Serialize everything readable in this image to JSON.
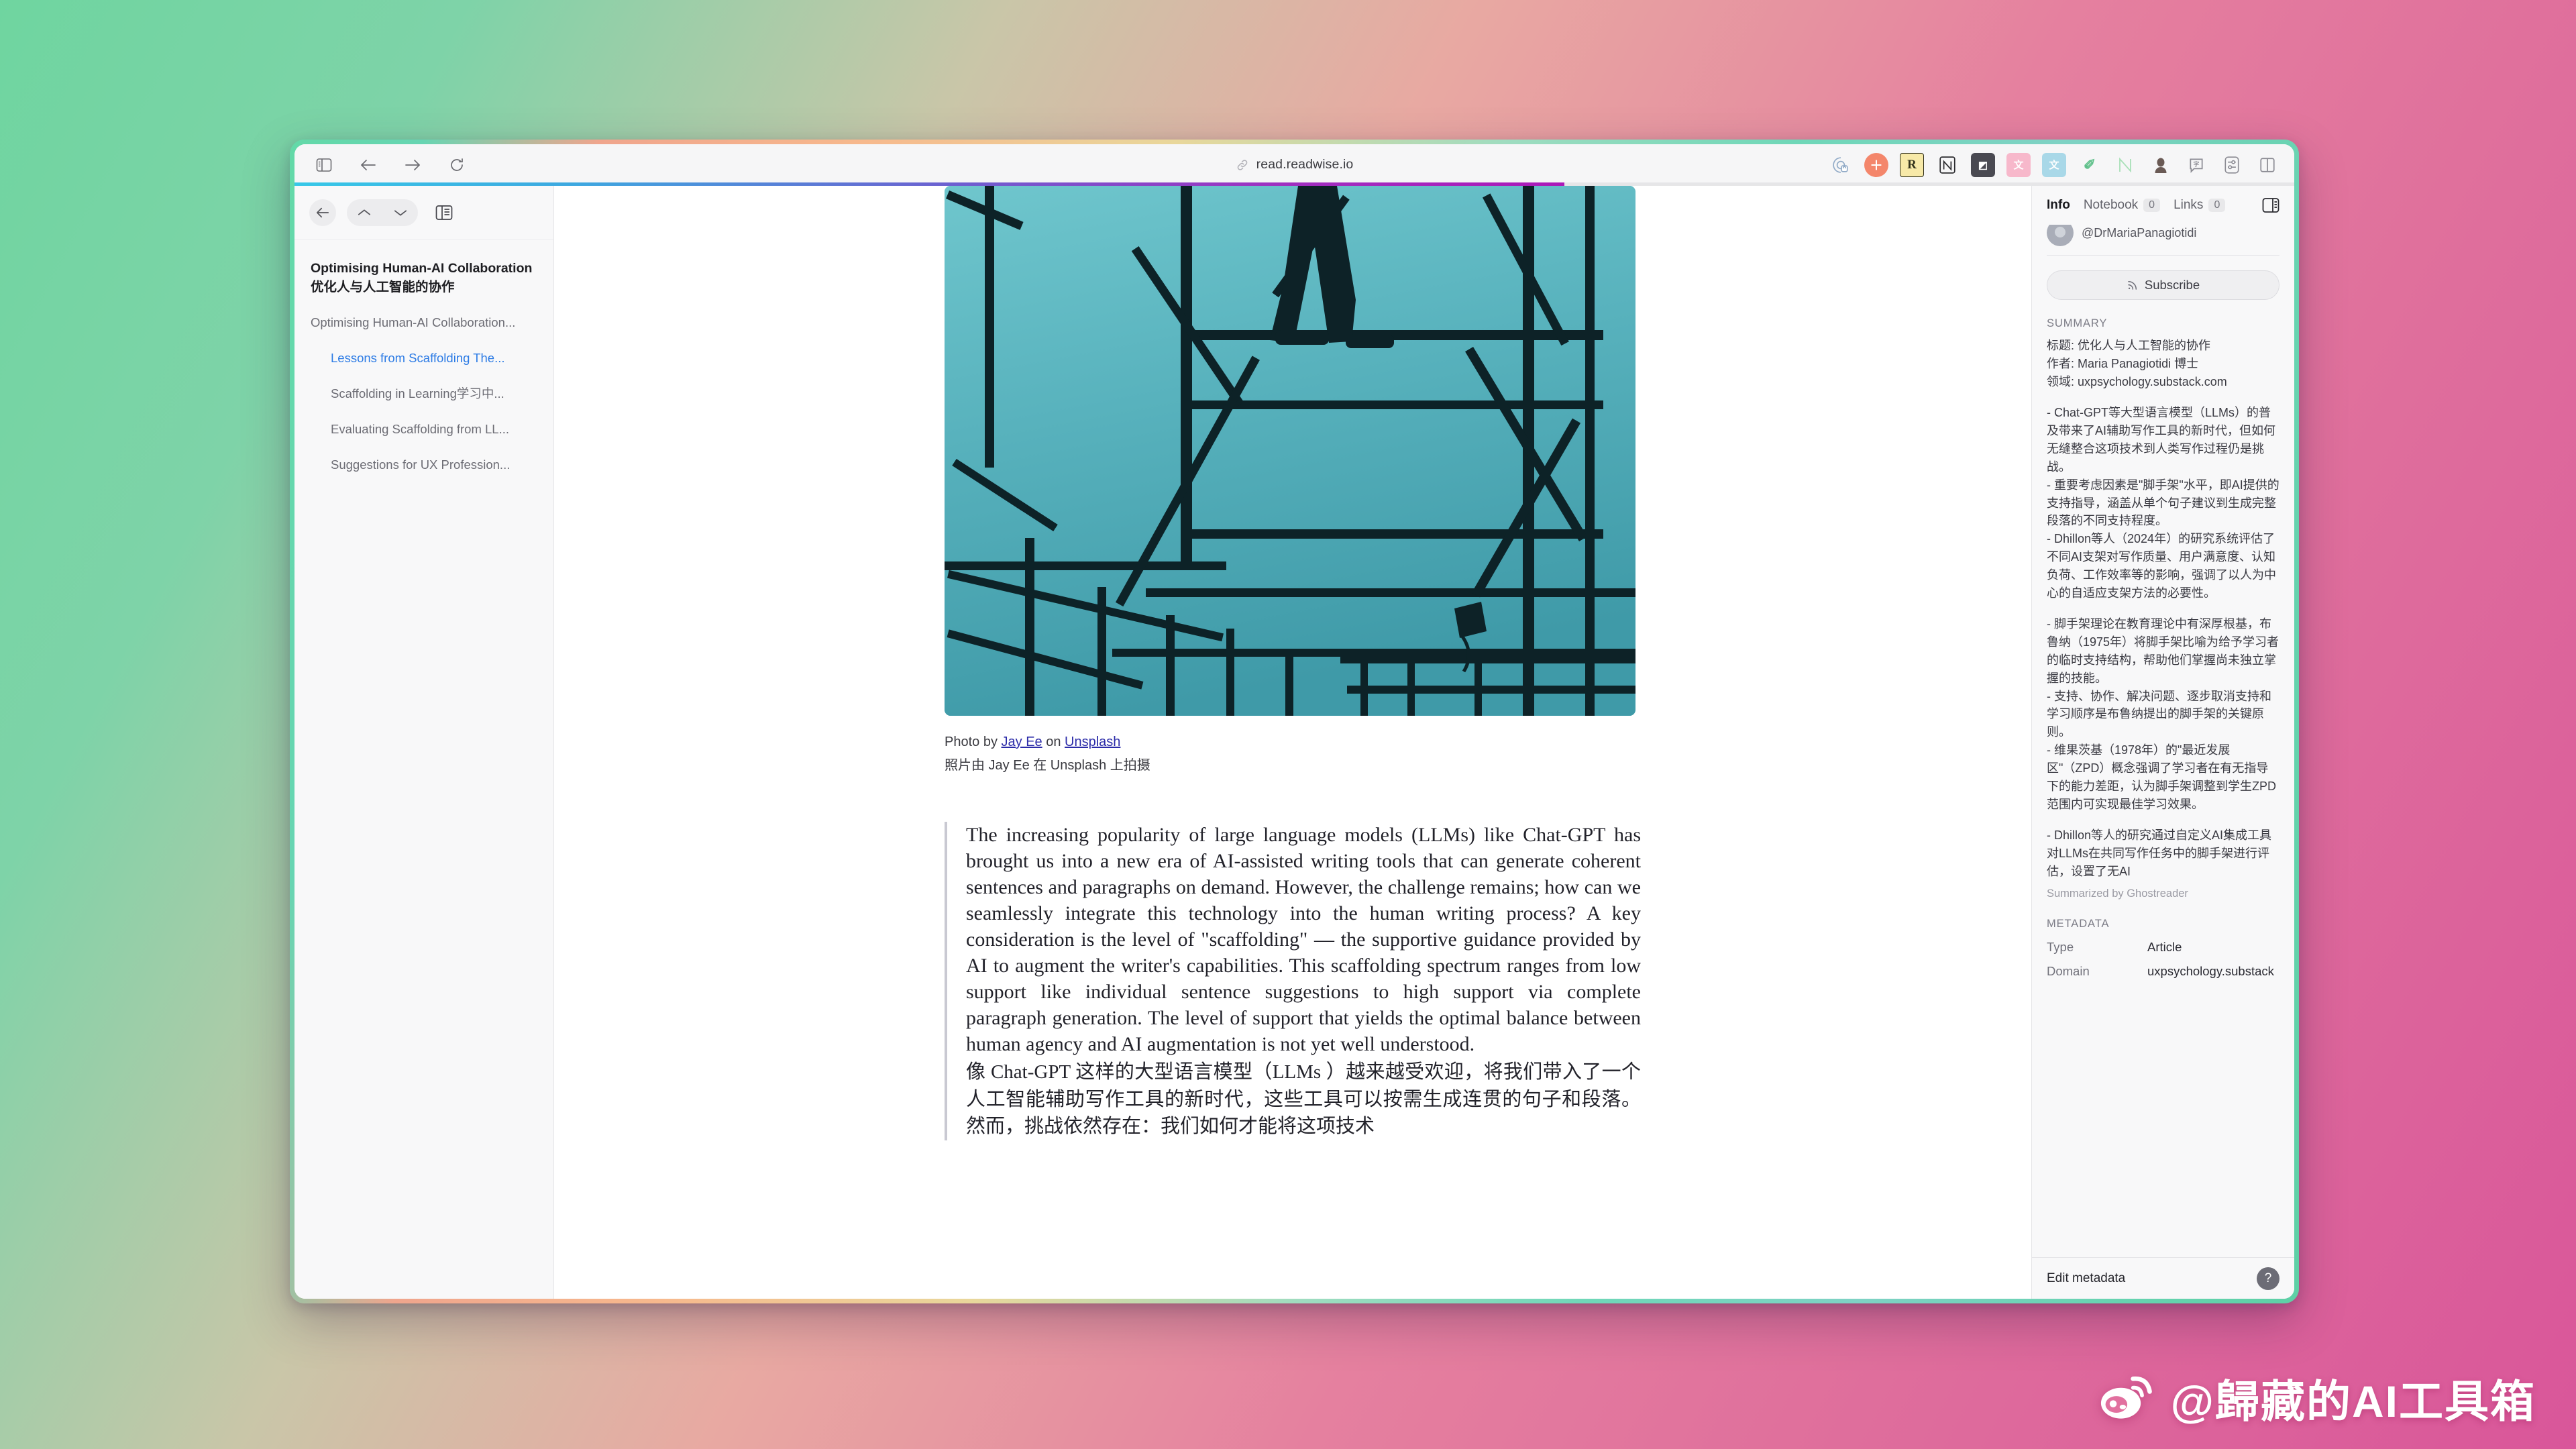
{
  "browser": {
    "url": "read.readwise.io",
    "nav": {
      "sidebar_toggle": "sidebar-toggle",
      "back": "back",
      "forward": "forward",
      "reload": "reload"
    },
    "extensions": [
      {
        "name": "privacy-badger-icon",
        "glyph": "◔",
        "bg": "transparent",
        "color": "#8fa9c6"
      },
      {
        "name": "orange-plus-extension-icon",
        "glyph": "✛",
        "bg": "#f4866b",
        "color": "#ffffff"
      },
      {
        "name": "readwise-extension-icon",
        "glyph": "R",
        "bg": "#f7e9a8",
        "color": "#3a3a22"
      },
      {
        "name": "notion-web-clipper-icon",
        "glyph": "N",
        "bg": "transparent",
        "color": "#2b2b2f"
      },
      {
        "name": "eagle-clip-extension-icon",
        "glyph": "◩",
        "bg": "#4a4a52",
        "color": "#ffffff"
      },
      {
        "name": "pink-translate-extension-icon",
        "glyph": "文",
        "bg": "#f7b8cb",
        "color": "#ffffff"
      },
      {
        "name": "immersive-translate-icon",
        "glyph": "文",
        "bg": "#a9d8e8",
        "color": "#ffffff"
      },
      {
        "name": "green-pen-extension-icon",
        "glyph": "✎",
        "bg": "transparent",
        "color": "#5fc08a"
      },
      {
        "name": "nimbus-extension-icon",
        "glyph": "N",
        "bg": "transparent",
        "color": "#a9e0b8"
      },
      {
        "name": "profile-avatar-icon",
        "glyph": "●",
        "bg": "transparent",
        "color": "#6a5a55"
      },
      {
        "name": "comment-bubble-extension-icon",
        "glyph": "⌨",
        "bg": "transparent",
        "color": "#8b8b93"
      },
      {
        "name": "settings-sliders-extension-icon",
        "glyph": "⚙",
        "bg": "transparent",
        "color": "#8b8b93"
      },
      {
        "name": "split-view-icon",
        "glyph": "◫",
        "bg": "transparent",
        "color": "#8b8b93"
      }
    ]
  },
  "sidebar": {
    "toolbar": {
      "back_label": "back",
      "prev_label": "previous",
      "next_label": "next",
      "panel_label": "document-outline"
    },
    "doc_title_en": "Optimising Human-AI Collaboration",
    "doc_title_zh": "优化人与人工智能的协作",
    "toc": [
      {
        "label": "Optimising Human-AI Collaboration...",
        "level": 1,
        "active": false
      },
      {
        "label": "Lessons from Scaffolding The...",
        "level": 2,
        "active": true
      },
      {
        "label": "Scaffolding in Learning学习中...",
        "level": 2,
        "active": false
      },
      {
        "label": "Evaluating Scaffolding from LL...",
        "level": 2,
        "active": false
      },
      {
        "label": "Suggestions for UX Profession...",
        "level": 2,
        "active": false
      }
    ]
  },
  "article": {
    "hero_alt": "scaffolding-photo",
    "caption": {
      "prefix": "Photo by ",
      "author": "Jay Ee",
      "middle": " on ",
      "source": "Unsplash",
      "zh": "照片由 Jay Ee 在 Unsplash 上拍摄"
    },
    "body_en": "The increasing popularity of large language models (LLMs) like Chat-GPT has brought us into a new era of AI-assisted writing tools that can generate coherent sentences and paragraphs on demand. However, the challenge remains; how can we seamlessly integrate this technology into the human writing process? A key consideration is the level of \"scaffolding\" — the supportive guidance provided by AI to augment the writer's capabilities. This scaffolding spectrum ranges from low support like individual sentence suggestions to high support via complete paragraph generation. The level of support that yields the optimal balance between human agency and AI augmentation is not yet well understood.",
    "body_zh": "像 Chat-GPT 这样的大型语言模型（LLMs ）越来越受欢迎，将我们带入了一个人工智能辅助写作工具的新时代，这些工具可以按需生成连贯的句子和段落。然而，挑战依然存在：我们如何才能将这项技术"
  },
  "info_panel": {
    "tabs": [
      {
        "label": "Info",
        "count": null,
        "active": true
      },
      {
        "label": "Notebook",
        "count": "0",
        "active": false
      },
      {
        "label": "Links",
        "count": "0",
        "active": false
      }
    ],
    "panel_toggle_name": "info-panel-toggle",
    "author_handle": "@DrMariaPanagiotidi",
    "subscribe_label": "Subscribe",
    "summary_label": "SUMMARY",
    "summary_head": "标题: 优化人与人工智能的协作\n作者: Maria Panagiotidi 博士\n领域: uxpsychology.substack.com",
    "summary_paragraphs": [
      "- Chat-GPT等大型语言模型（LLMs）的普及带来了AI辅助写作工具的新时代，但如何无缝整合这项技术到人类写作过程仍是挑战。\n- 重要考虑因素是\"脚手架\"水平，即AI提供的支持指导，涵盖从单个句子建议到生成完整段落的不同支持程度。\n- Dhillon等人（2024年）的研究系统评估了不同AI支架对写作质量、用户满意度、认知负荷、工作效率等的影响，强调了以人为中心的自适应支架方法的必要性。",
      "- 脚手架理论在教育理论中有深厚根基，布鲁纳（1975年）将脚手架比喻为给予学习者的临时支持结构，帮助他们掌握尚未独立掌握的技能。\n- 支持、协作、解决问题、逐步取消支持和学习顺序是布鲁纳提出的脚手架的关键原则。\n- 维果茨基（1978年）的\"最近发展区\"（ZPD）概念强调了学习者在有无指导下的能力差距，认为脚手架调整到学生ZPD范围内可实现最佳学习效果。",
      "- Dhillon等人的研究通过自定义AI集成工具对LLMs在共同写作任务中的脚手架进行评估，设置了无AI"
    ],
    "summary_credit": "Summarized by Ghostreader",
    "metadata_label": "METADATA",
    "metadata": [
      {
        "key": "Type",
        "value": "Article"
      },
      {
        "key": "Domain",
        "value": "uxpsychology.substack"
      }
    ],
    "edit_metadata_label": "Edit metadata",
    "help_label": "?"
  },
  "watermark": {
    "text": "@歸藏的AI工具箱",
    "logo_name": "weibo-logo"
  },
  "colors": {
    "accent_blue": "#2c7be5",
    "progress_start": "#37c8e8",
    "progress_end": "#ab18b8",
    "bg_start": "#6fd5a0",
    "bg_end": "#d9569a"
  }
}
